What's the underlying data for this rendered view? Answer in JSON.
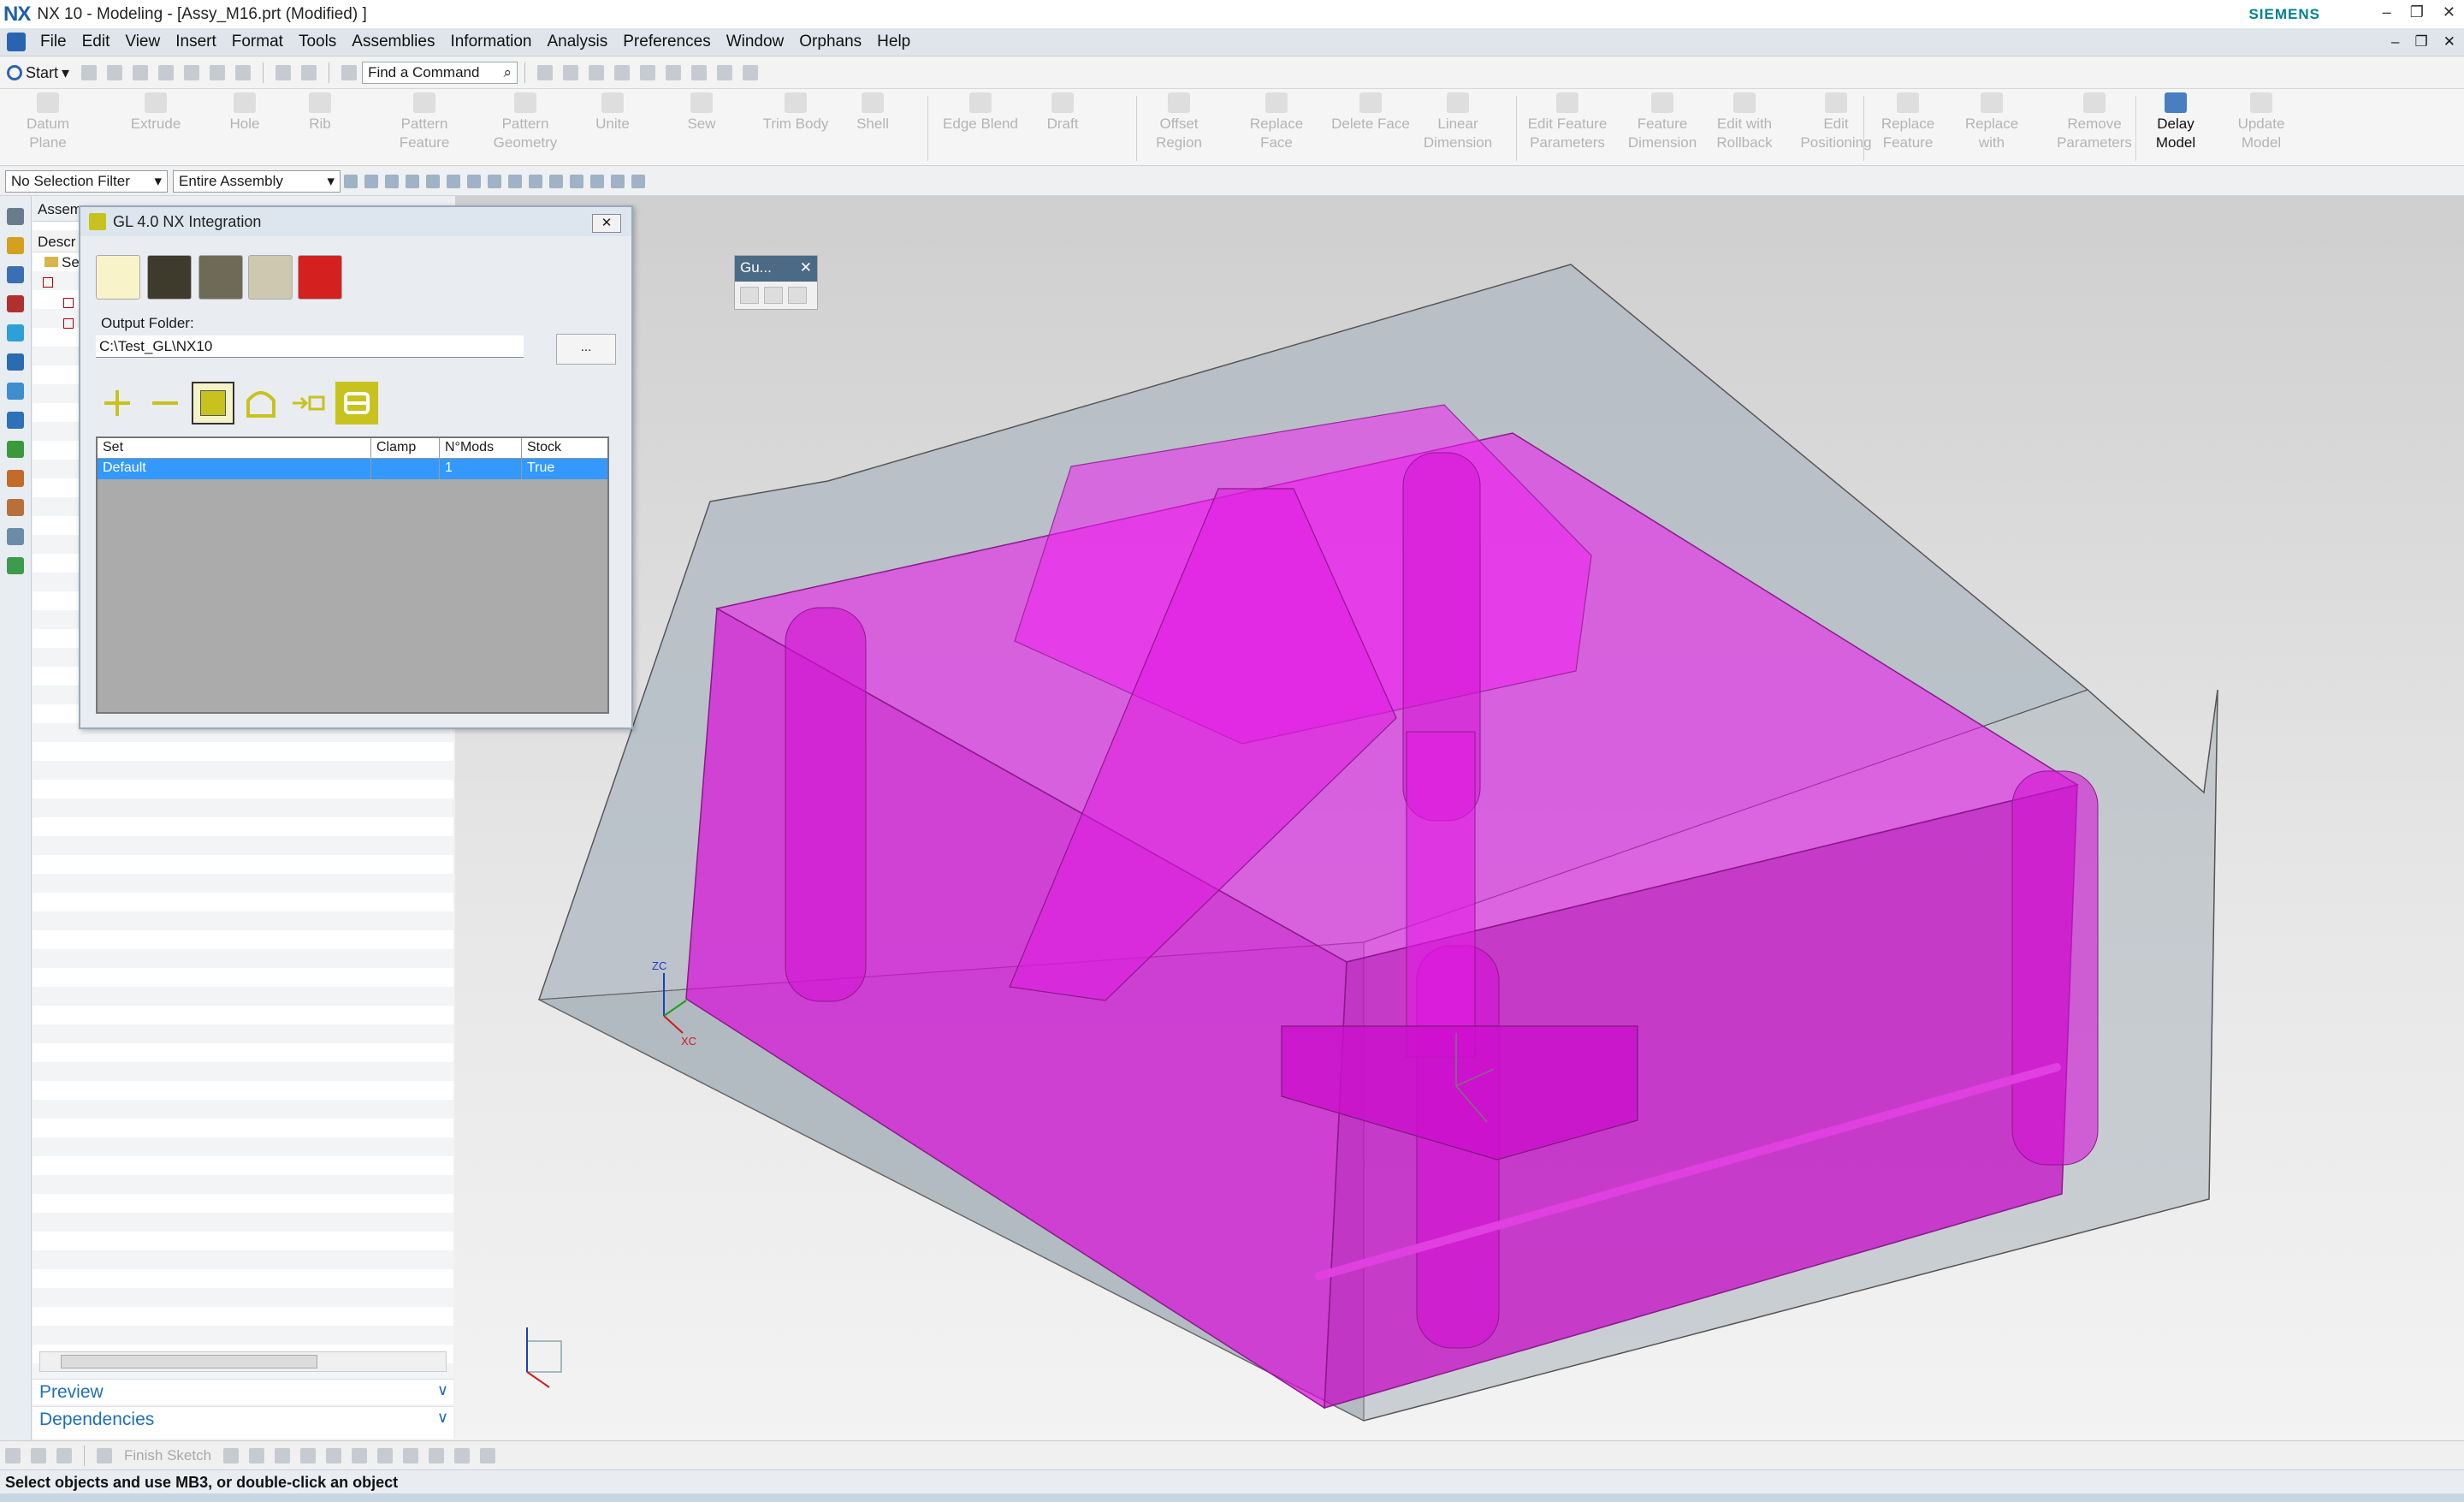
{
  "window": {
    "logo": "NX",
    "title": "NX 10 - Modeling - [Assy_M16.prt (Modified) ]",
    "brand": "SIEMENS"
  },
  "menu": [
    "File",
    "Edit",
    "View",
    "Insert",
    "Format",
    "Tools",
    "Assemblies",
    "Information",
    "Analysis",
    "Preferences",
    "Window",
    "Orphans",
    "Help"
  ],
  "quickbar": {
    "start_label": "Start",
    "find_command": "Find a Command"
  },
  "ribbon": [
    {
      "label": "Datum\nPlane",
      "active": false
    },
    {
      "label": "Extrude",
      "active": false
    },
    {
      "label": "Hole",
      "active": false
    },
    {
      "label": "Rib",
      "active": false
    },
    {
      "label": "Pattern\nFeature",
      "active": false
    },
    {
      "label": "Pattern\nGeometry",
      "active": false
    },
    {
      "label": "Unite",
      "active": false
    },
    {
      "label": "Sew",
      "active": false
    },
    {
      "label": "Trim Body",
      "active": false
    },
    {
      "label": "Shell",
      "active": false
    },
    {
      "label": "Edge Blend",
      "active": false
    },
    {
      "label": "Draft",
      "active": false
    },
    {
      "label": "Offset\nRegion",
      "active": false
    },
    {
      "label": "Replace\nFace",
      "active": false
    },
    {
      "label": "Delete Face",
      "active": false
    },
    {
      "label": "Linear\nDimension",
      "active": false
    },
    {
      "label": "Edit Feature\nParameters",
      "active": false
    },
    {
      "label": "Feature\nDimension",
      "active": false
    },
    {
      "label": "Edit with\nRollback",
      "active": false
    },
    {
      "label": "Edit\nPositioning",
      "active": false
    },
    {
      "label": "Replace\nFeature",
      "active": false
    },
    {
      "label": "Replace\nwith",
      "active": false
    },
    {
      "label": "Remove\nParameters",
      "active": false
    },
    {
      "label": "Delay\nModel",
      "active": true
    },
    {
      "label": "Update\nModel",
      "active": false
    }
  ],
  "selection": {
    "filter": "No Selection Filter",
    "scope": "Entire Assembly"
  },
  "navigator": {
    "header": "Assem",
    "column": "Descr",
    "tree_item": "Se",
    "sections": [
      "Preview",
      "Dependencies"
    ]
  },
  "gl_dialog": {
    "title": "GL 4.0 NX Integration",
    "output_label": "Output Folder:",
    "output_value": "C:\\Test_GL\\NX10",
    "browse_label": "...",
    "table": {
      "columns": [
        "Set",
        "Clamp",
        "N°Mods",
        "Stock"
      ],
      "rows": [
        [
          "Default",
          "",
          "1",
          "True"
        ]
      ]
    }
  },
  "gu_toolbar": {
    "title": "Gu...",
    "close": "✕"
  },
  "viewport": {
    "triad": {
      "zc": "ZC",
      "xc": "XC"
    },
    "colors": {
      "part_fill": "#ee11ee",
      "box_fill": "#9aa7b1",
      "background_top": "#cfcfcf"
    }
  },
  "sketchbar": {
    "finish_sketch": "Finish Sketch"
  },
  "status": "Select objects and use MB3, or double-click an object"
}
